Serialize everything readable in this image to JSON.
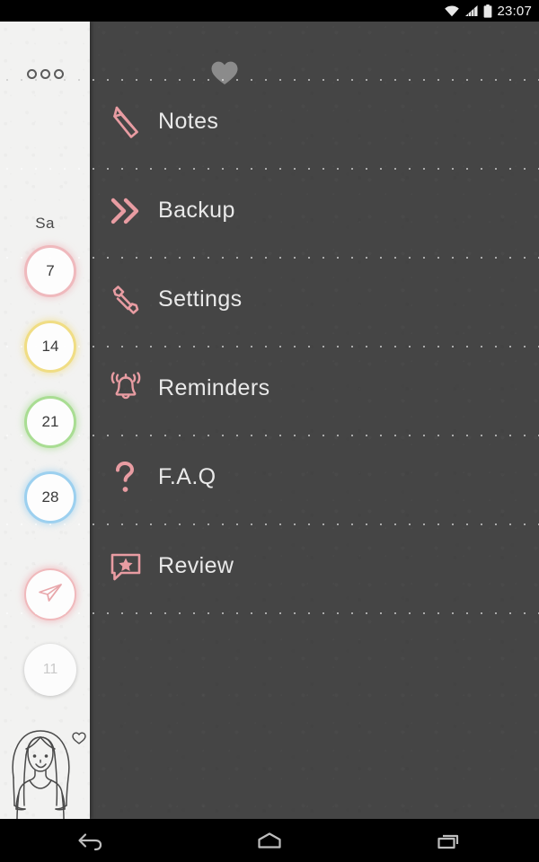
{
  "statusbar": {
    "time": "23:07",
    "icons": [
      "wifi-icon",
      "cellular-signal-icon",
      "battery-icon"
    ]
  },
  "sidebar": {
    "menu_icon": "three-circles-menu-icon",
    "day_label": "Sa",
    "days": [
      {
        "number": "7",
        "color": "#efb9bd"
      },
      {
        "number": "14",
        "color": "#f0dd84"
      },
      {
        "number": "21",
        "color": "#a9dd93"
      },
      {
        "number": "28",
        "color": "#9cd0ef"
      }
    ],
    "send_icon": "paper-plane-icon",
    "muted_day": "11",
    "avatar": "girl-avatar-illustration",
    "avatar_heart": "heart-outline-icon"
  },
  "main": {
    "header_icon": "heart-filled-icon",
    "accent_color": "#e89ca2",
    "text_color": "#e9e9e9",
    "items": [
      {
        "label": "Notes",
        "icon": "pencil-icon"
      },
      {
        "label": "Backup",
        "icon": "double-chevron-right-icon"
      },
      {
        "label": "Settings",
        "icon": "wrench-icon"
      },
      {
        "label": "Reminders",
        "icon": "bell-ringing-icon"
      },
      {
        "label": "F.A.Q",
        "icon": "question-mark-icon"
      },
      {
        "label": "Review",
        "icon": "speech-bubble-star-icon"
      }
    ]
  },
  "navbar": {
    "buttons": [
      {
        "name": "back-button",
        "icon": "back-arrow-icon"
      },
      {
        "name": "home-button",
        "icon": "home-icon"
      },
      {
        "name": "recents-button",
        "icon": "recent-apps-icon"
      }
    ]
  }
}
